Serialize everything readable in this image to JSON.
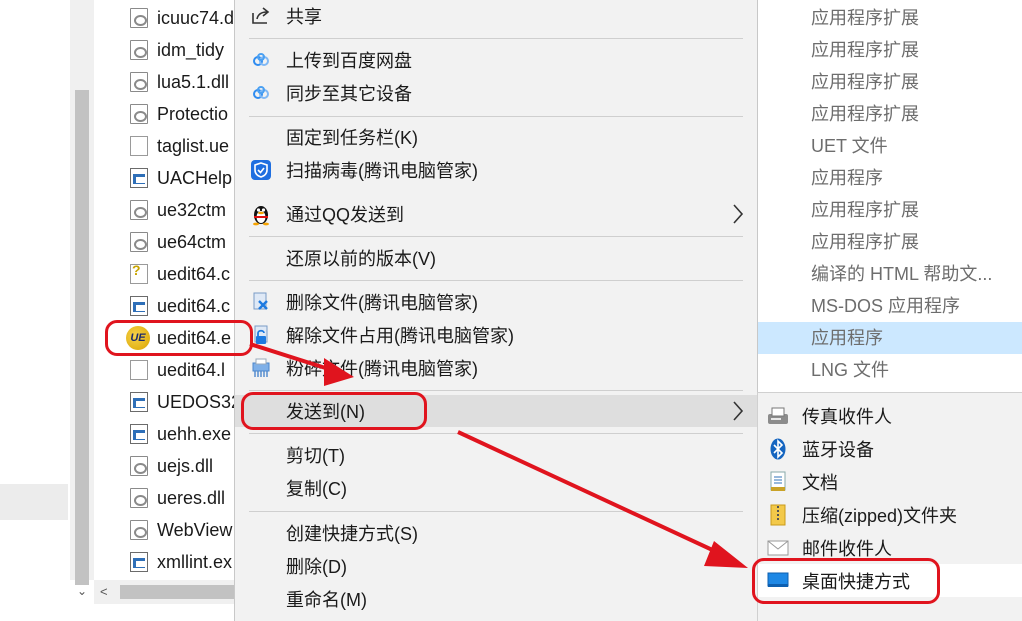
{
  "file_list": [
    {
      "name": "icuuc74.d",
      "icon": "dll-file-icon"
    },
    {
      "name": "idm_tidy",
      "icon": "dll-file-icon"
    },
    {
      "name": "lua5.1.dll",
      "icon": "dll-file-icon"
    },
    {
      "name": "Protectio",
      "icon": "dll-file-icon"
    },
    {
      "name": "taglist.ue",
      "icon": "text-file-icon"
    },
    {
      "name": "UACHelp",
      "icon": "exe-file-icon"
    },
    {
      "name": "ue32ctm",
      "icon": "dll-file-icon"
    },
    {
      "name": "ue64ctm",
      "icon": "dll-file-icon"
    },
    {
      "name": "uedit64.c",
      "icon": "help-file-icon"
    },
    {
      "name": "uedit64.c",
      "icon": "exe-file-icon"
    },
    {
      "name": "uedit64.e",
      "icon": "ue-app-icon",
      "highlighted": true
    },
    {
      "name": "uedit64.l",
      "icon": "text-file-icon"
    },
    {
      "name": "UEDOS32",
      "icon": "exe-file-icon"
    },
    {
      "name": "uehh.exe",
      "icon": "exe-file-icon"
    },
    {
      "name": "uejs.dll",
      "icon": "dll-file-icon"
    },
    {
      "name": "ueres.dll",
      "icon": "dll-file-icon"
    },
    {
      "name": "WebView",
      "icon": "dll-file-icon"
    },
    {
      "name": "xmllint.ex",
      "icon": "exe-file-icon"
    }
  ],
  "type_column": [
    "应用程序扩展",
    "应用程序扩展",
    "应用程序扩展",
    "应用程序扩展",
    "UET 文件",
    "应用程序",
    "应用程序扩展",
    "应用程序扩展",
    "编译的 HTML 帮助文...",
    "MS-DOS 应用程序",
    "应用程序",
    "LNG 文件"
  ],
  "type_selected_index": 10,
  "context_menu": {
    "share": "共享",
    "upload_baidu": "上传到百度网盘",
    "sync_devices": "同步至其它设备",
    "pin_taskbar": "固定到任务栏(K)",
    "scan_virus": "扫描病毒(腾讯电脑管家)",
    "send_via_qq": "通过QQ发送到",
    "restore_versions": "还原以前的版本(V)",
    "delete_file_tencent": "删除文件(腾讯电脑管家)",
    "unlock_file": "解除文件占用(腾讯电脑管家)",
    "shred_file": "粉碎文件(腾讯电脑管家)",
    "send_to": "发送到(N)",
    "cut": "剪切(T)",
    "copy": "复制(C)",
    "create_shortcut": "创建快捷方式(S)",
    "delete": "删除(D)",
    "rename": "重命名(M)"
  },
  "send_to_submenu": {
    "fax_recipient": "传真收件人",
    "bluetooth": "蓝牙设备",
    "documents": "文档",
    "zip_folder": "压缩(zipped)文件夹",
    "mail_recipient": "邮件收件人",
    "desktop_shortcut": "桌面快捷方式"
  },
  "colors": {
    "annotation_red": "#e0141e",
    "selection_blue": "#cce8ff",
    "menu_bg": "#f2f2f2"
  }
}
